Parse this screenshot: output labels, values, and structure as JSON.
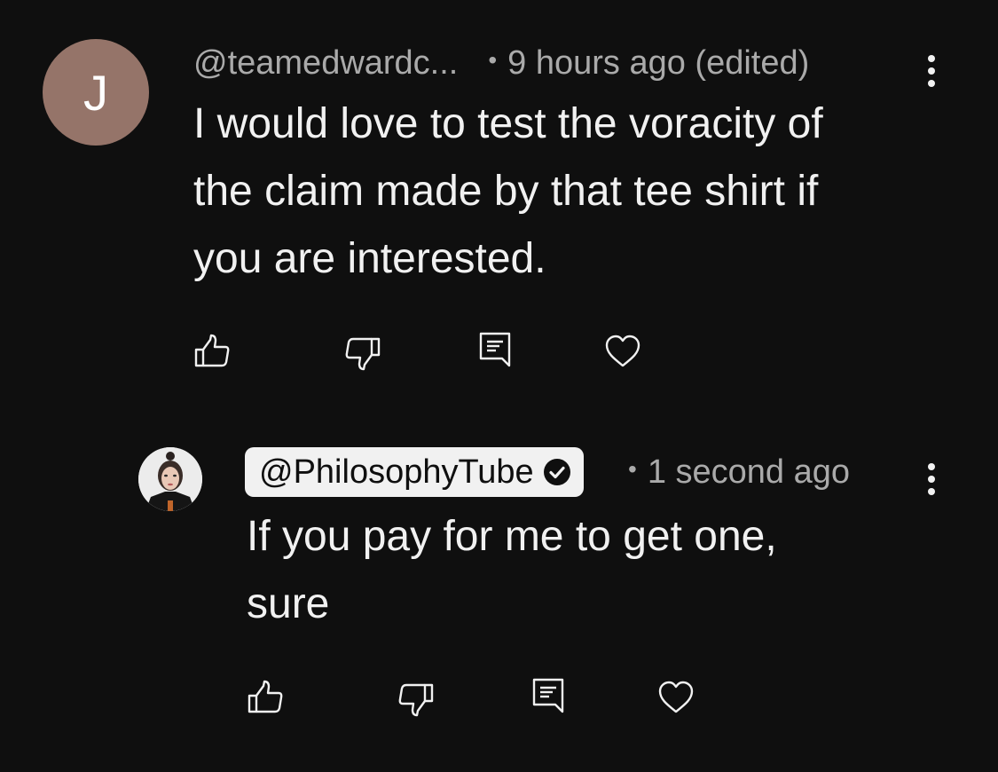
{
  "comment": {
    "avatar_letter": "J",
    "handle": "@teamedwardc...",
    "separator": "•",
    "timestamp": "9 hours ago (edited)",
    "text_lines": [
      "I would love to test the voracity of",
      "the claim made by that tee shirt if",
      "you are interested."
    ],
    "actions": [
      "like",
      "dislike",
      "reply",
      "heart"
    ]
  },
  "reply": {
    "handle": "@PhilosophyTube",
    "verified": true,
    "separator": "•",
    "timestamp": "1 second ago",
    "text_lines": [
      "If you pay for me to get one,",
      "sure"
    ],
    "actions": [
      "like",
      "dislike",
      "reply",
      "heart"
    ]
  },
  "colors": {
    "background": "#0f0f0f",
    "primary_text": "#f1f1f1",
    "secondary_text": "#aaaaaa",
    "avatar_letter_bg": "#957469",
    "creator_chip_bg": "#f1f1f1"
  }
}
